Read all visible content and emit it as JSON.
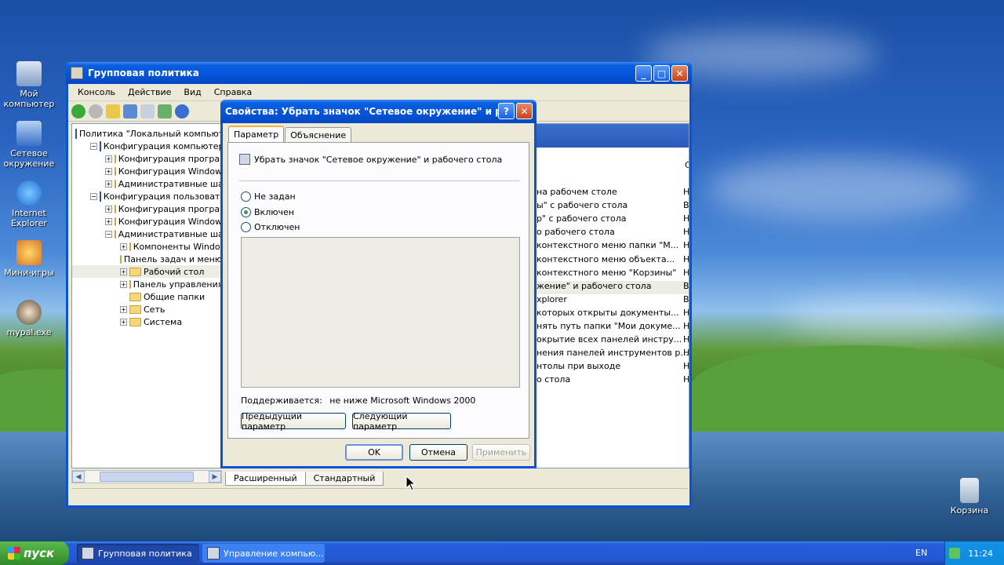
{
  "desktop": {
    "icons": [
      {
        "label": "Мой компьютер"
      },
      {
        "label": "Сетевое окружение"
      },
      {
        "label": "Internet Explorer"
      },
      {
        "label": "Мини-игры"
      },
      {
        "label": "mypal.exe"
      },
      {
        "label": "Корзина"
      }
    ]
  },
  "main_window": {
    "title": "Групповая политика",
    "menu": [
      "Консоль",
      "Действие",
      "Вид",
      "Справка"
    ],
    "tree": [
      {
        "label": "Политика \"Локальный компьюте",
        "level": 0,
        "exp": ""
      },
      {
        "label": "Конфигурация компьютера",
        "level": 1,
        "exp": "−"
      },
      {
        "label": "Конфигурация программ",
        "level": 2,
        "exp": "+"
      },
      {
        "label": "Конфигурация Windows",
        "level": 2,
        "exp": "+"
      },
      {
        "label": "Административные шабл",
        "level": 2,
        "exp": "+"
      },
      {
        "label": "Конфигурация пользователя",
        "level": 1,
        "exp": "−"
      },
      {
        "label": "Конфигурация программ",
        "level": 2,
        "exp": "+"
      },
      {
        "label": "Конфигурация Windows",
        "level": 2,
        "exp": "+"
      },
      {
        "label": "Административные шабл",
        "level": 2,
        "exp": "−"
      },
      {
        "label": "Компоненты Windows",
        "level": 3,
        "exp": "+"
      },
      {
        "label": "Панель задач и меню",
        "level": 3,
        "exp": ""
      },
      {
        "label": "Рабочий стол",
        "level": 3,
        "exp": "+"
      },
      {
        "label": "Панель управления",
        "level": 3,
        "exp": "+"
      },
      {
        "label": "Общие папки",
        "level": 3,
        "exp": ""
      },
      {
        "label": "Сеть",
        "level": 3,
        "exp": "+"
      },
      {
        "label": "Система",
        "level": 3,
        "exp": "+"
      }
    ],
    "list_header_state": "С",
    "list_rows": [
      {
        "text": "на рабочем столе",
        "state": "Н"
      },
      {
        "text": "ы\" с рабочего стола",
        "state": "В"
      },
      {
        "text": "р\" с рабочего стола",
        "state": "Н"
      },
      {
        "text": "о рабочего стола",
        "state": "Н"
      },
      {
        "text": "контекстного меню папки \"М...",
        "state": "Н"
      },
      {
        "text": "контекстного меню объекта...",
        "state": "Н"
      },
      {
        "text": "контекстного меню \"Корзины\"",
        "state": "Н"
      },
      {
        "text": "жение\" и рабочего стола",
        "state": "В"
      },
      {
        "text": "xplorer",
        "state": "В"
      },
      {
        "text": "которых открыты документы...",
        "state": "Н"
      },
      {
        "text": "нять путь папки \"Мои докуме...",
        "state": "Н"
      },
      {
        "text": "окрытие всех панелей инстру...",
        "state": "Н"
      },
      {
        "text": "нения панелей инструментов р...",
        "state": "Н"
      },
      {
        "text": "нтолы при выходе",
        "state": "Н"
      },
      {
        "text": "о стола",
        "state": "Н"
      }
    ],
    "bottom_tabs": [
      "Расширенный",
      "Стандартный"
    ]
  },
  "dialog": {
    "title": "Свойства: Убрать значок \"Сетевое окружение\" и р...",
    "tabs": [
      "Параметр",
      "Объяснение"
    ],
    "policy_name": "Убрать значок \"Сетевое окружение\" и рабочего стола",
    "radios": [
      {
        "label": "Не задан",
        "checked": false
      },
      {
        "label": "Включен",
        "checked": true
      },
      {
        "label": "Отключен",
        "checked": false
      }
    ],
    "supported_label": "Поддерживается:",
    "supported_value": "не ниже Microsoft Windows 2000",
    "prev_button": "Предыдущий параметр",
    "next_button": "Следующий параметр",
    "ok": "OK",
    "cancel": "Отмена",
    "apply": "Применить"
  },
  "taskbar": {
    "start": "пуск",
    "tasks": [
      {
        "label": "Групповая политика",
        "active": true
      },
      {
        "label": "Управление компью..."
      }
    ],
    "lang": "EN",
    "clock": "11:24"
  }
}
